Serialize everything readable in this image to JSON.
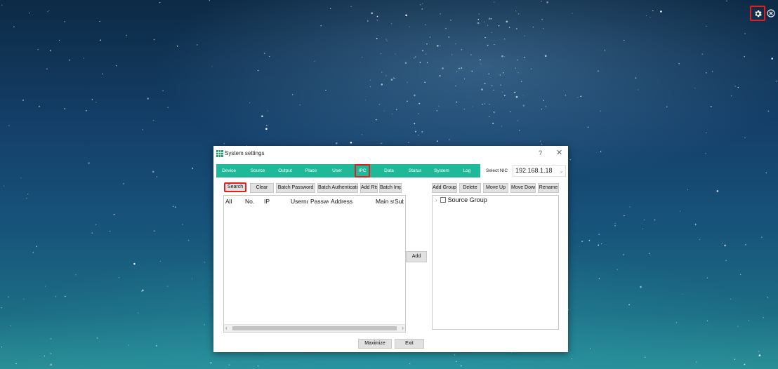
{
  "desktop": {
    "icons": {
      "settings": "gear-icon",
      "close": "close-circle-icon"
    }
  },
  "dialog": {
    "title": "System settings",
    "help": "?",
    "close": "✕",
    "tabs": [
      "Device",
      "Source",
      "Output",
      "Place",
      "User",
      "IPC",
      "Data",
      "Status",
      "System",
      "Log"
    ],
    "active_tab": "IPC",
    "nic_label": "Select NIC",
    "nic_value": "192.168.1.18",
    "left_buttons": [
      "Search",
      "Clear",
      "Batch Password",
      "Batch Authentication",
      "Add Rtsp Address",
      "Batch Import"
    ],
    "list_columns": [
      "All",
      "No.",
      "IP",
      "Username",
      "Password",
      "Address",
      "Main stream",
      "Sub stream"
    ],
    "right_buttons": [
      "Add Group",
      "Delete",
      "Move Up",
      "Move Down",
      "Rename"
    ],
    "add_button": "Add",
    "tree_root": "Source Group",
    "footer_buttons": [
      "Maximize",
      "Exit"
    ],
    "colors": {
      "tab_bar": "#1fb99a",
      "highlight": "#e02020"
    }
  }
}
